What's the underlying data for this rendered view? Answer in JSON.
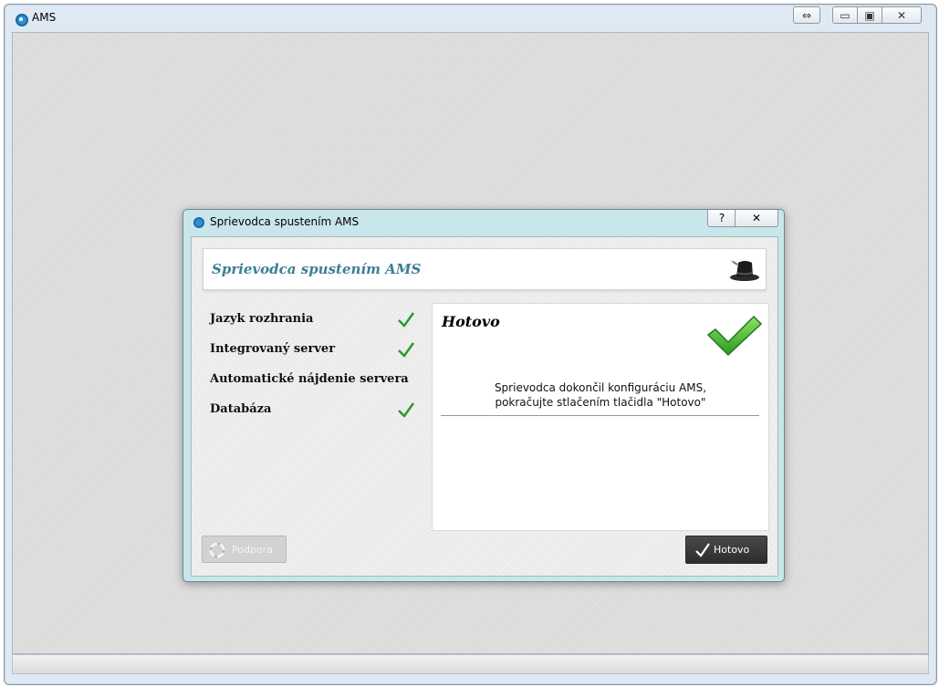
{
  "main_window": {
    "title": "AMS",
    "buttons": {
      "resize_label": "⇔",
      "minimize_label": "▭",
      "maximize_label": "▣",
      "close_label": "✕"
    }
  },
  "dialog": {
    "title": "Sprievodca spustením AMS",
    "help_label": "?",
    "close_label": "✕",
    "header_title": "Sprievodca spustením AMS",
    "steps": [
      {
        "label": "Jazyk rozhrania",
        "completed": true
      },
      {
        "label": "Integrovaný server",
        "completed": true
      },
      {
        "label": "Automatické nájdenie servera",
        "completed": false
      },
      {
        "label": "Databáza",
        "completed": true
      }
    ],
    "panel": {
      "title": "Hotovo",
      "message_line1": "Sprievodca dokončil konfiguráciu AMS,",
      "message_line2": "pokračujte stlačením tlačidla \"Hotovo\""
    },
    "support_button_label": "Podpora",
    "done_button_label": "Hotovo"
  },
  "colors": {
    "accent_title": "#3a7f93",
    "check_green": "#2a9a2a",
    "dialog_frame": "#c9e6ea",
    "done_button": "#2d2d2d"
  },
  "icons": {
    "app": "location-pin-icon",
    "header": "magic-hat-icon",
    "check": "checkmark-icon",
    "support": "lifebuoy-icon"
  }
}
